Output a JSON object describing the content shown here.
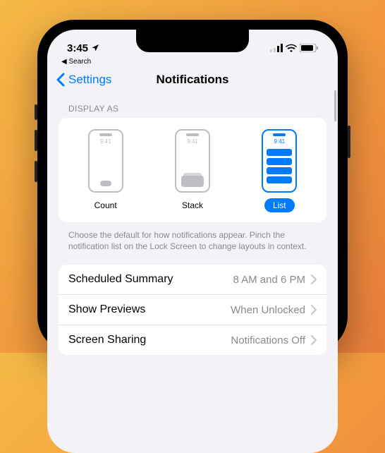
{
  "status_bar": {
    "time": "3:45",
    "back_to_label": "Search"
  },
  "nav": {
    "back_label": "Settings",
    "title": "Notifications"
  },
  "display_as": {
    "header": "DISPLAY AS",
    "options": [
      {
        "label": "Count",
        "selected": false,
        "preview_time": "9:41"
      },
      {
        "label": "Stack",
        "selected": false,
        "preview_time": "9:41"
      },
      {
        "label": "List",
        "selected": true,
        "preview_time": "9:41"
      }
    ],
    "footer": "Choose the default for how notifications appear. Pinch the notification list on the Lock Screen to change layouts in context."
  },
  "rows": [
    {
      "label": "Scheduled Summary",
      "value": "8 AM and 6 PM"
    },
    {
      "label": "Show Previews",
      "value": "When Unlocked"
    },
    {
      "label": "Screen Sharing",
      "value": "Notifications Off"
    }
  ]
}
